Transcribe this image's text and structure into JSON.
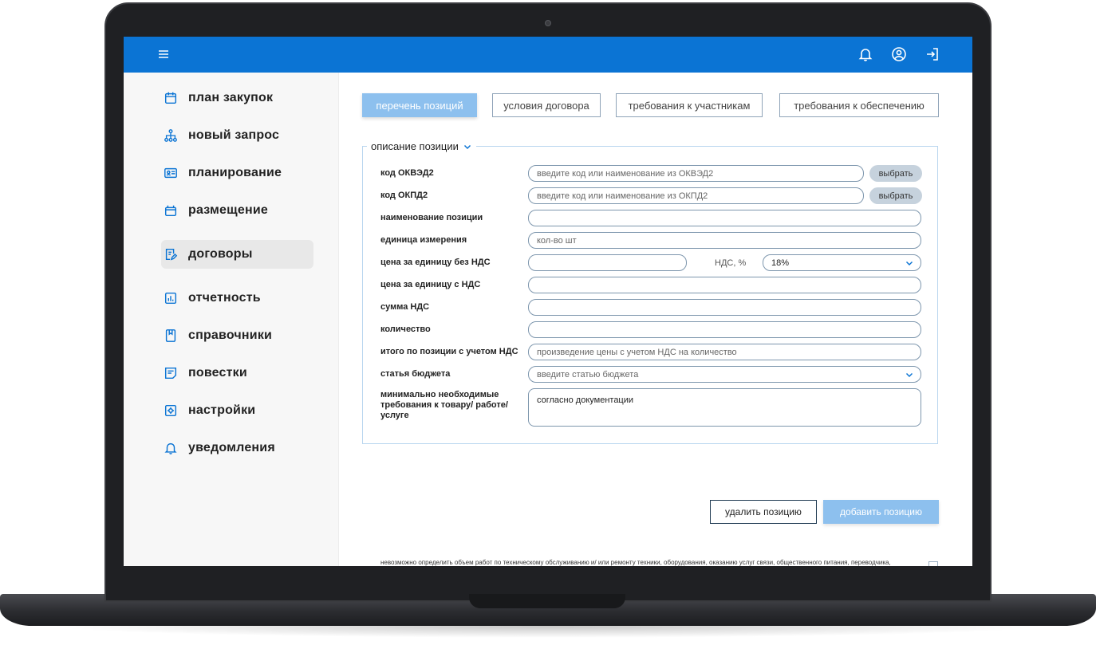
{
  "header": {
    "menu_icon": "menu-icon",
    "notification_icon": "bell-icon",
    "profile_icon": "user-circle-icon",
    "logout_icon": "logout-icon"
  },
  "sidebar": {
    "items": [
      {
        "label": "план закупок",
        "icon": "calendar-icon"
      },
      {
        "label": "новый запрос",
        "icon": "hierarchy-icon"
      },
      {
        "label": "планирование",
        "icon": "id-card-icon"
      },
      {
        "label": "размещение",
        "icon": "box-icon"
      },
      {
        "label": "договоры",
        "icon": "document-edit-icon",
        "active": true
      },
      {
        "label": "отчетность",
        "icon": "bar-chart-icon"
      },
      {
        "label": "справочники",
        "icon": "book-icon"
      },
      {
        "label": "повестки",
        "icon": "notes-icon"
      },
      {
        "label": "настройки",
        "icon": "gear-icon"
      },
      {
        "label": "уведомления",
        "icon": "bell-icon"
      }
    ]
  },
  "tabs": [
    {
      "label": "перечень позиций",
      "active": true
    },
    {
      "label": "условия договора"
    },
    {
      "label": "требования к участникам"
    },
    {
      "label": "требования к обеспечению"
    }
  ],
  "form": {
    "legend": "описание позиции",
    "fields": {
      "okved": {
        "label": "код ОКВЭД2",
        "placeholder": "введите код или наименование из ОКВЭД2",
        "button": "выбрать"
      },
      "okpd": {
        "label": "код ОКПД2",
        "placeholder": "введите код или наименование из ОКПД2",
        "button": "выбрать"
      },
      "name": {
        "label": "наименование позиции",
        "value": ""
      },
      "unit": {
        "label": "единица измерения",
        "value": "кол-во шт"
      },
      "price_net": {
        "label": "цена за единицу без НДС",
        "value": ""
      },
      "vat": {
        "label": "НДС, %",
        "value": "18%"
      },
      "price_gross": {
        "label": "цена за единицу с НДС",
        "value": ""
      },
      "vat_sum": {
        "label": "сумма НДС",
        "value": ""
      },
      "quantity": {
        "label": "количество",
        "value": ""
      },
      "total": {
        "label": "итого по позиции с учетом НДС",
        "placeholder": "произведение цены с учетом НДС на количество"
      },
      "budget": {
        "label": "статья бюджета",
        "placeholder": "введите статью бюджета"
      },
      "requirements": {
        "label": "минимально необходимые требования к товару/ работе/ услуге",
        "value": "согласно документации"
      }
    }
  },
  "actions": {
    "delete": "удалить позицию",
    "add": "добавить позицию"
  },
  "footer_note": {
    "text": "невозможно определить объем работ по техническому обслуживанию и/ или ремонту техники, оборудования, оказанию услуг связи, общественного питания, переводчика, проведения оценки, перевозки груза, пассажиров и багажа, юридических, медицинских, образовательных, гостиничных услуг.",
    "checked": false
  },
  "colors": {
    "brand": "#0b74d4",
    "tab_active": "#8dc0ee",
    "border": "#7d96ad"
  }
}
